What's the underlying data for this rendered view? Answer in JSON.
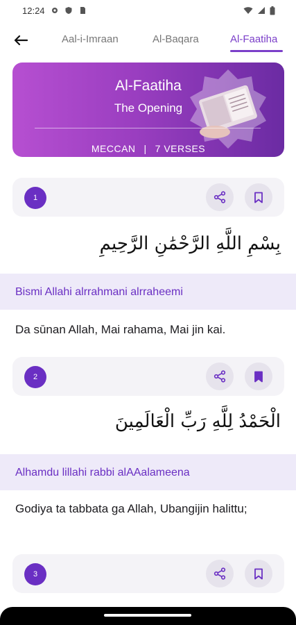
{
  "status_bar": {
    "time": "12:24"
  },
  "tabs": [
    {
      "label": "Aal-i-Imraan",
      "active": false
    },
    {
      "label": "Al-Baqara",
      "active": false
    },
    {
      "label": "Al-Faatiha",
      "active": true
    }
  ],
  "surah": {
    "name": "Al-Faatiha",
    "translation": "The Opening",
    "revelation": "MECCAN",
    "separator": "|",
    "verses_label": "7 VERSES"
  },
  "verses": [
    {
      "number": "1",
      "arabic": "بِسْمِ اللَّهِ الرَّحْمَٰنِ الرَّحِيمِ",
      "transliteration": "Bismi Allahi alrrahmani alrraheemi",
      "translation": "Da sūnan Allah, Mai rahama, Mai jin kai.",
      "bookmarked": false
    },
    {
      "number": "2",
      "arabic": "الْحَمْدُ لِلَّهِ رَبِّ الْعَالَمِينَ",
      "transliteration": "Alhamdu lillahi rabbi alAAalameena",
      "translation": "Godiya ta tabbata ga Allah, Ubangijin halittu;",
      "bookmarked": true
    },
    {
      "number": "3",
      "bookmarked": false
    }
  ],
  "colors": {
    "accent": "#7b3fc9",
    "badge": "#6a2fc3",
    "translit_bg": "#eeeaf9",
    "card_bg": "#f4f3f7"
  },
  "icons": {
    "back": "arrow-left-icon",
    "share": "share-icon",
    "bookmark": "bookmark-icon"
  }
}
